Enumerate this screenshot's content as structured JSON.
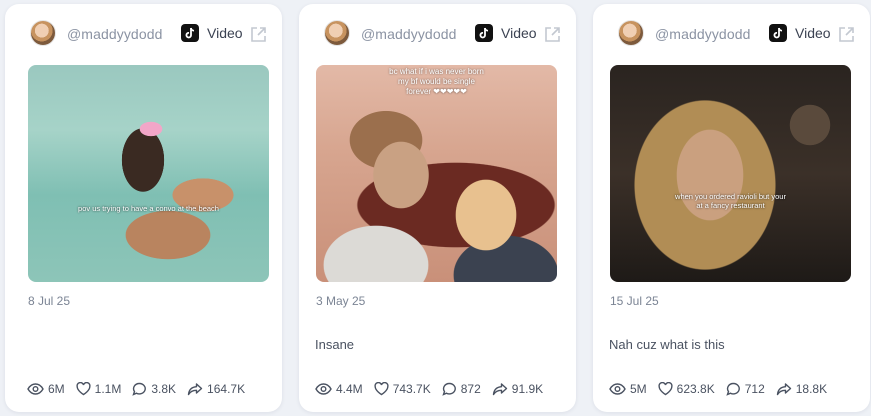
{
  "cards": [
    {
      "handle": "@maddyydodd",
      "platform_label": "Video",
      "thumb_top_text": "",
      "thumb_text": "pov us trying to have a convo at the beach",
      "date": "8 Jul 25",
      "caption": "",
      "stats": {
        "views": "6M",
        "likes": "1.1M",
        "comments": "3.8K",
        "shares": "164.7K"
      }
    },
    {
      "handle": "@maddyydodd",
      "platform_label": "Video",
      "thumb_top_text": "bc what if i was never born my bf would be single forever ❤❤❤❤❤",
      "thumb_text": "",
      "date": "3 May 25",
      "caption": "Insane",
      "stats": {
        "views": "4.4M",
        "likes": "743.7K",
        "comments": "872",
        "shares": "91.9K"
      }
    },
    {
      "handle": "@maddyydodd",
      "platform_label": "Video",
      "thumb_top_text": "",
      "thumb_text": "when you ordered ravioli but your at a fancy restaurant",
      "date": "15 Jul 25",
      "caption": "Nah cuz what is this",
      "stats": {
        "views": "5M",
        "likes": "623.8K",
        "comments": "712",
        "shares": "18.8K"
      }
    }
  ],
  "icons": {
    "platform": "tiktok-icon",
    "external": "external-link-icon",
    "views": "eye-icon",
    "likes": "heart-icon",
    "comments": "comment-icon",
    "shares": "share-icon"
  }
}
